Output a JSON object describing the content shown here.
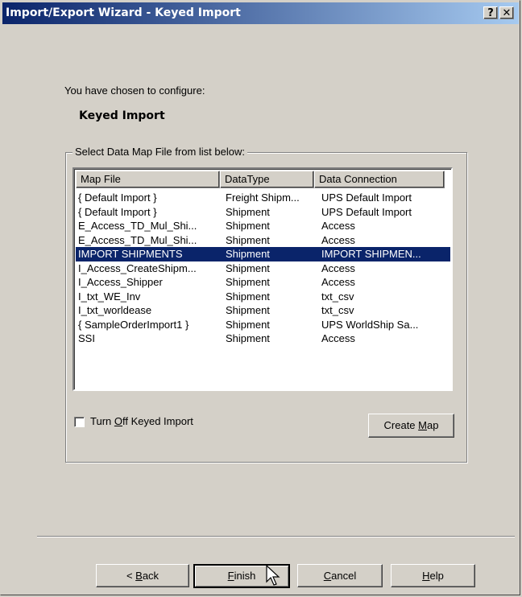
{
  "window": {
    "title": "Import/Export Wizard - Keyed Import",
    "help_btn": "?",
    "close_btn": "✕"
  },
  "intro": {
    "text": "You have chosen to configure:",
    "subject": "Keyed Import"
  },
  "group": {
    "label": "Select Data Map File from list below:"
  },
  "list": {
    "columns": [
      "Map File",
      "DataType",
      "Data Connection"
    ],
    "rows": [
      [
        "{ Default Import }",
        "Freight Shipm...",
        "UPS Default Import"
      ],
      [
        "{ Default Import }",
        "Shipment",
        "UPS Default Import"
      ],
      [
        "E_Access_TD_Mul_Shi...",
        "Shipment",
        "Access"
      ],
      [
        "E_Access_TD_Mul_Shi...",
        "Shipment",
        "Access"
      ],
      [
        "IMPORT SHIPMENTS",
        "Shipment",
        "IMPORT SHIPMEN..."
      ],
      [
        "I_Access_CreateShipm...",
        "Shipment",
        "Access"
      ],
      [
        "I_Access_Shipper",
        "Shipment",
        "Access"
      ],
      [
        "I_txt_WE_Inv",
        "Shipment",
        "txt_csv"
      ],
      [
        "I_txt_worldease",
        "Shipment",
        "txt_csv"
      ],
      [
        "{ SampleOrderImport1 }",
        "Shipment",
        "UPS WorldShip Sa..."
      ],
      [
        "SSI",
        "Shipment",
        "Access"
      ]
    ],
    "selected_index": 4
  },
  "checkbox": {
    "label_pre": "Turn ",
    "label_key": "O",
    "label_post": "ff Keyed Import",
    "checked": false
  },
  "buttons": {
    "create_map_pre": "Create ",
    "create_map_key": "M",
    "create_map_post": "ap",
    "back_pre": "< ",
    "back_key": "B",
    "back_post": "ack",
    "finish_key": "F",
    "finish_post": "inish",
    "cancel_key": "C",
    "cancel_post": "ancel",
    "help_key": "H",
    "help_post": "elp"
  },
  "colors": {
    "selection": "#0a246a",
    "face": "#d4d0c8"
  }
}
